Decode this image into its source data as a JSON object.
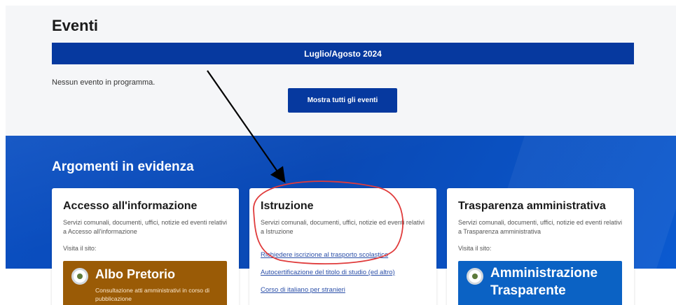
{
  "events": {
    "title": "Eventi",
    "month_label": "Luglio/Agosto 2024",
    "empty_message": "Nessun evento in programma.",
    "show_all_label": "Mostra tutti gli eventi"
  },
  "topics": {
    "title": "Argomenti in evidenza",
    "cards": [
      {
        "title": "Accesso all'informazione",
        "description": "Servizi comunali, documenti, uffici, notizie ed eventi relativi a Accesso all'informazione",
        "visit_label": "Visita il sito:",
        "banner_title": "Albo Pretorio",
        "banner_subtitle": "Consultazione atti amministrativi in corso di pubblicazione",
        "banner_icon": "emblem-icon"
      },
      {
        "title": "Istruzione",
        "description": "Servizi comunali, documenti, uffici, notizie ed eventi relativi a Istruzione",
        "links": [
          "Richiedere iscrizione al trasporto scolastico",
          "Autocertificazione del titolo di studio (ed altro)",
          "Corso di italiano per stranieri"
        ]
      },
      {
        "title": "Trasparenza amministrativa",
        "description": "Servizi comunali, documenti, uffici, notizie ed eventi relativi a Trasparenza amministrativa",
        "visit_label": "Visita il sito:",
        "banner_title_line1": "Amministrazione",
        "banner_title_line2": "Trasparente",
        "banner_icon": "emblem-icon"
      }
    ]
  },
  "colors": {
    "primary": "#06399f",
    "band": "#0a4fc2",
    "albo_banner": "#9a5b06",
    "trasparenza_banner": "#0b62c4",
    "annotation_circle": "#e03b3b",
    "annotation_arrow": "#000000"
  }
}
